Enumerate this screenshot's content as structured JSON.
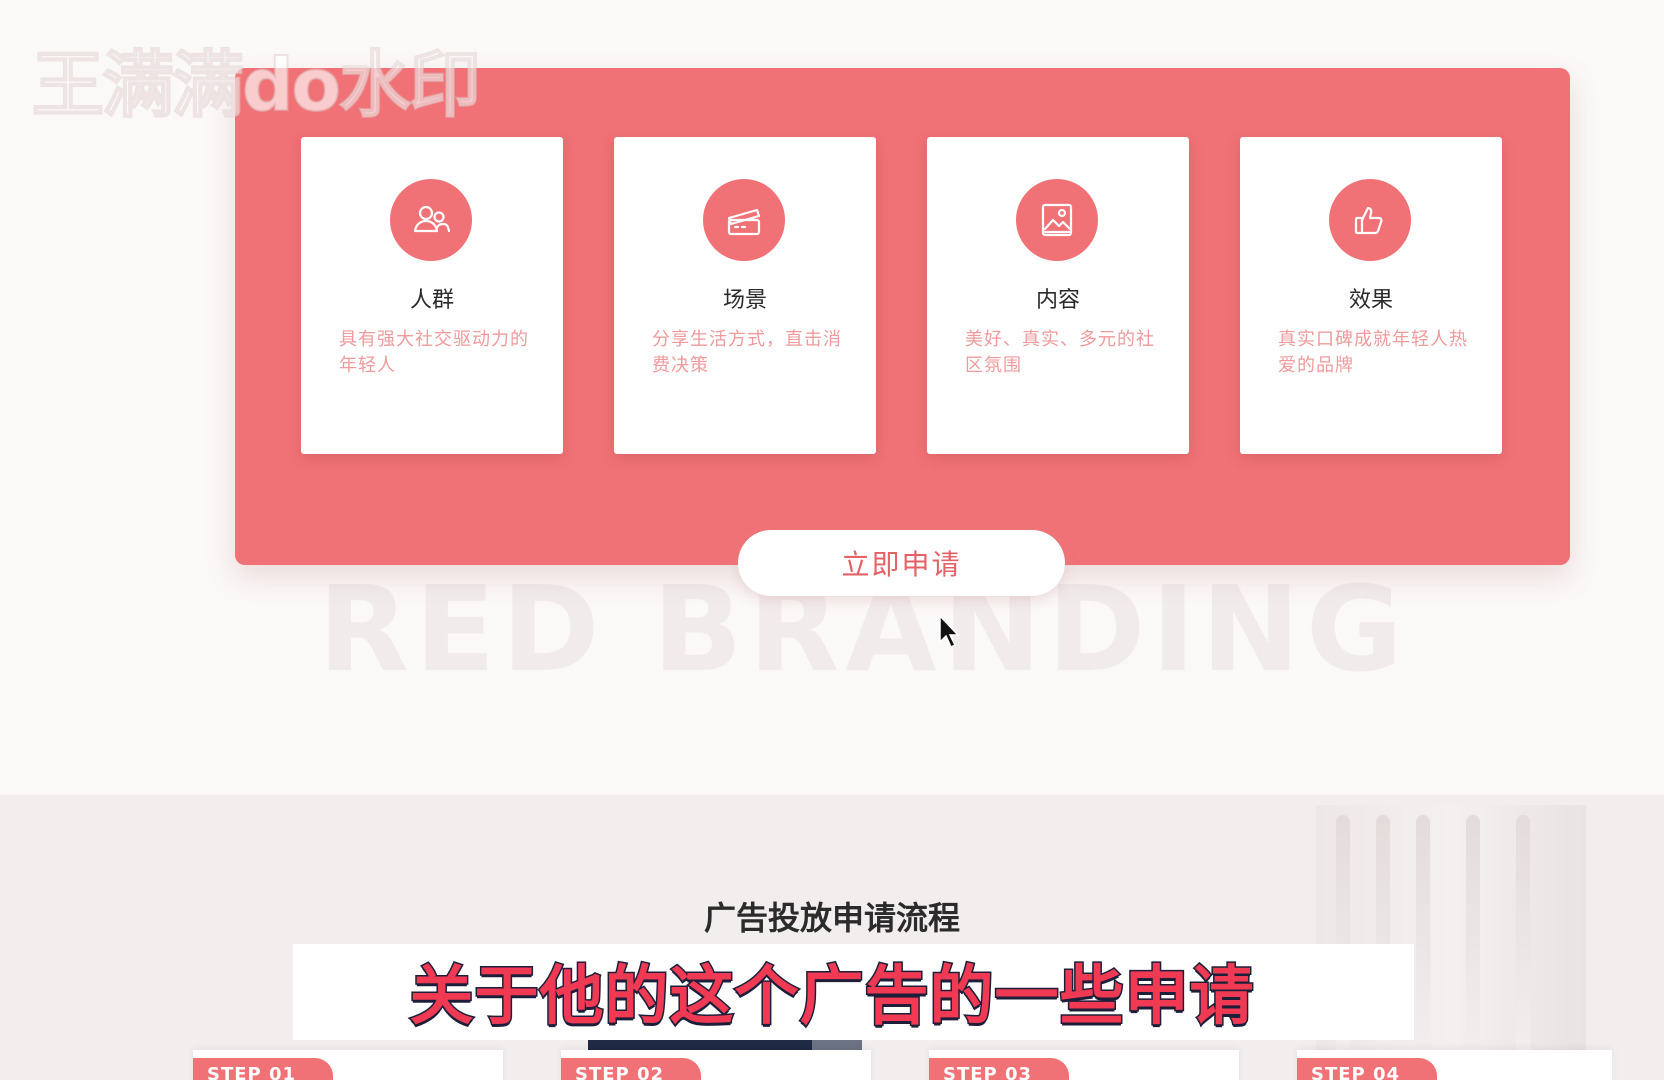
{
  "watermark": "王满满do水印",
  "background_word": "RED BRANDING",
  "features": [
    {
      "title": "人群",
      "desc": "具有强大社交驱动力的年轻人",
      "icon": "people-icon"
    },
    {
      "title": "场景",
      "desc": "分享生活方式，直击消费决策",
      "icon": "clapperboard-icon"
    },
    {
      "title": "内容",
      "desc": "美好、真实、多元的社区氛围",
      "icon": "image-icon"
    },
    {
      "title": "效果",
      "desc": "真实口碑成就年轻人热爱的品牌",
      "icon": "thumbs-up-icon"
    }
  ],
  "apply_button": "立即申请",
  "process": {
    "title": "广告投放申请流程",
    "steps": [
      "STEP 01",
      "STEP 02",
      "STEP 03",
      "STEP 04"
    ]
  },
  "video_subtitle": "关于他的这个广告的一些申请",
  "colors": {
    "brand_red": "#f07276",
    "text_dark": "#2a2a2a",
    "desc_pink": "#f09a9c",
    "subtitle_red": "#f03a54",
    "subtitle_stroke": "#1d1f3a"
  }
}
